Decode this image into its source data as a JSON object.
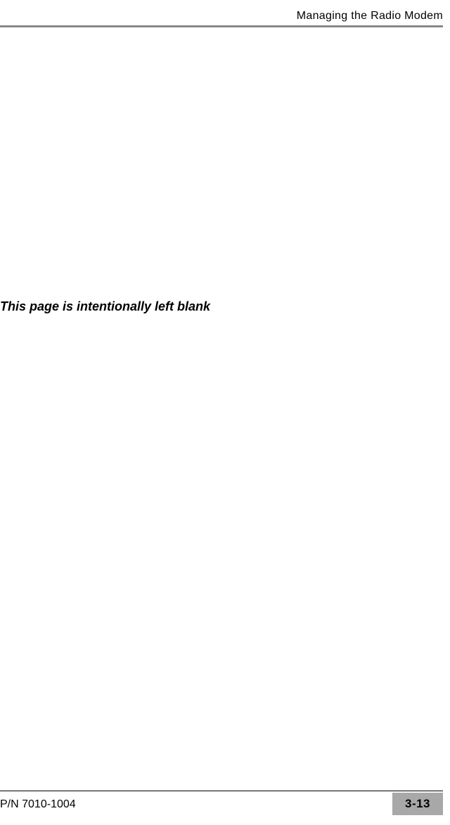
{
  "header": {
    "title": "Managing the Radio Modem"
  },
  "body": {
    "message": "This page is intentionally left blank"
  },
  "footer": {
    "part_number": "P/N 7010-1004",
    "page_number": "3-13"
  }
}
